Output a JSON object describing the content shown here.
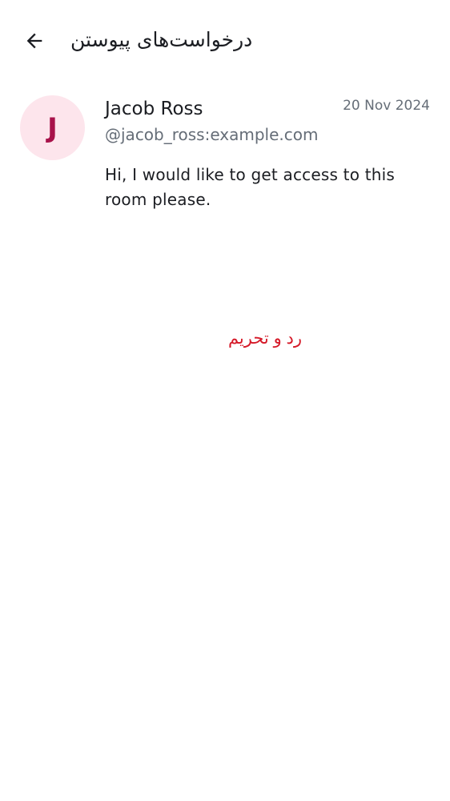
{
  "header": {
    "title": "درخواست‌های پیوستن",
    "back_icon": "arrow-left-icon"
  },
  "request": {
    "avatar_initial": "J",
    "display_name": "Jacob Ross",
    "user_id": "@jacob_ross:example.com",
    "date": "20 Nov 2024",
    "message": "Hi, I would like to get access to this room please.",
    "decline_label": "رد و تحریم"
  },
  "colors": {
    "avatar_bg": "#fde5ec",
    "avatar_text": "#a8124a",
    "secondary_text": "#656d77",
    "critical": "#d51928",
    "primary_text": "#1b1d22"
  }
}
